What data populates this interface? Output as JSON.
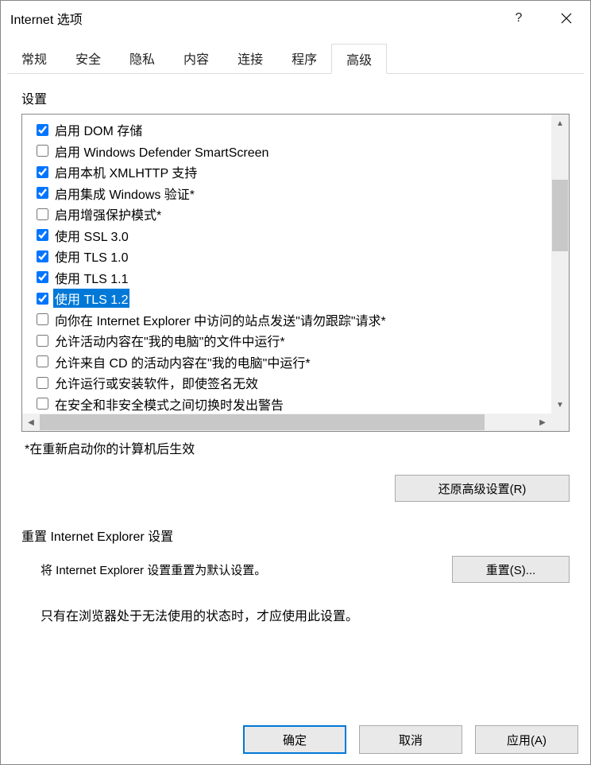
{
  "titlebar": {
    "title": "Internet 选项",
    "help": "?",
    "close": "✕"
  },
  "tabs": {
    "items": [
      {
        "label": "常规"
      },
      {
        "label": "安全"
      },
      {
        "label": "隐私"
      },
      {
        "label": "内容"
      },
      {
        "label": "连接"
      },
      {
        "label": "程序"
      },
      {
        "label": "高级"
      }
    ],
    "active_index": 6
  },
  "settings": {
    "group_label": "设置",
    "items": [
      {
        "checked": true,
        "label": "启用 DOM 存储"
      },
      {
        "checked": false,
        "label": "启用 Windows Defender SmartScreen"
      },
      {
        "checked": true,
        "label": "启用本机 XMLHTTP 支持"
      },
      {
        "checked": true,
        "label": "启用集成 Windows 验证*"
      },
      {
        "checked": false,
        "label": "启用增强保护模式*"
      },
      {
        "checked": true,
        "label": "使用 SSL 3.0"
      },
      {
        "checked": true,
        "label": "使用 TLS 1.0"
      },
      {
        "checked": true,
        "label": "使用 TLS 1.1"
      },
      {
        "checked": true,
        "label": "使用 TLS 1.2",
        "selected": true
      },
      {
        "checked": false,
        "label": "向你在 Internet Explorer 中访问的站点发送\"请勿跟踪\"请求*"
      },
      {
        "checked": false,
        "label": "允许活动内容在\"我的电脑\"的文件中运行*"
      },
      {
        "checked": false,
        "label": "允许来自 CD 的活动内容在\"我的电脑\"中运行*"
      },
      {
        "checked": false,
        "label": "允许运行或安装软件，即使签名无效"
      },
      {
        "checked": false,
        "label": "在安全和非安全模式之间切换时发出警告"
      }
    ],
    "note": "*在重新启动你的计算机后生效",
    "restore_button": "还原高级设置(R)"
  },
  "reset": {
    "heading": "重置 Internet Explorer 设置",
    "description": "将 Internet Explorer 设置重置为默认设置。",
    "button": "重置(S)...",
    "note": "只有在浏览器处于无法使用的状态时，才应使用此设置。"
  },
  "dialog_buttons": {
    "ok": "确定",
    "cancel": "取消",
    "apply": "应用(A)"
  }
}
